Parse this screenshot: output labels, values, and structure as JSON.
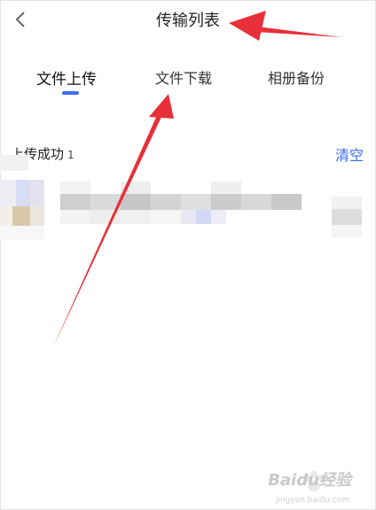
{
  "header": {
    "title": "传输列表"
  },
  "tabs": [
    {
      "label": "文件上传",
      "active": true
    },
    {
      "label": "文件下载",
      "active": false
    },
    {
      "label": "相册备份",
      "active": false
    }
  ],
  "section": {
    "title": "上传成功",
    "count": "1",
    "clear_label": "清空"
  },
  "colors": {
    "accent": "#3d6bf0",
    "annotation_arrow": "#e8303a"
  },
  "watermark": {
    "text": "Baidu经验",
    "sub": "jingyan.baidu.com"
  }
}
